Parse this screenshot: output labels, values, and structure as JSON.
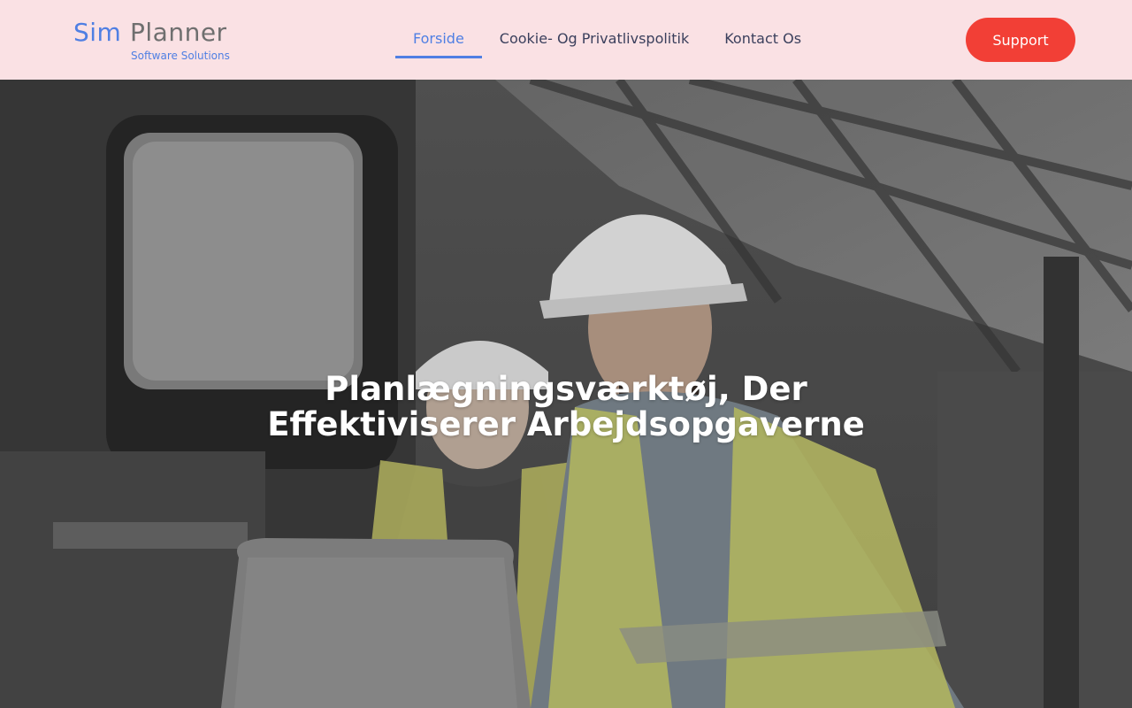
{
  "brand": {
    "name_first": "Sim",
    "name_second": "Planner",
    "tagline": "Software Solutions"
  },
  "nav": {
    "items": [
      {
        "label": "Forside",
        "active": true
      },
      {
        "label": "Cookie- Og Privatlivspolitik",
        "active": false
      },
      {
        "label": "Kontact Os",
        "active": false
      }
    ]
  },
  "header": {
    "support_label": "Support"
  },
  "hero": {
    "title": "Planlægningsværktøj, Der Effektiviserer Arbejdsopgaverne"
  },
  "colors": {
    "header_bg": "#fae1e4",
    "accent": "#4f7fe3",
    "support_bg": "#f23f36"
  }
}
